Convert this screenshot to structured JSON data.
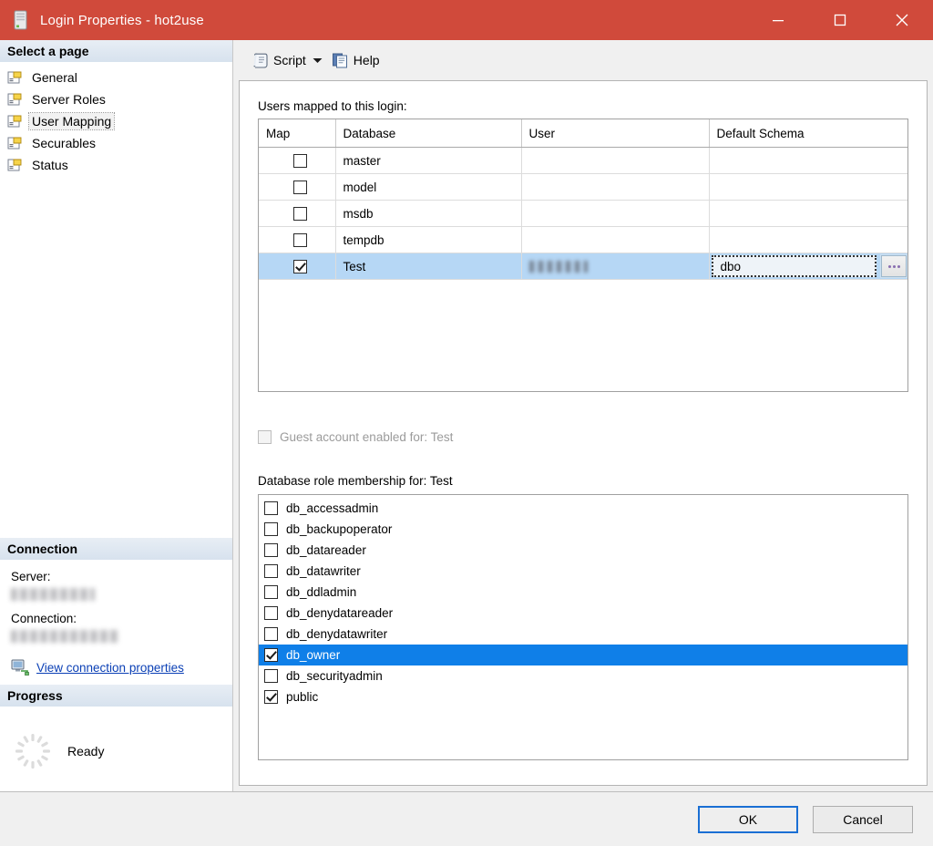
{
  "window": {
    "title": "Login Properties - hot2use",
    "icon": "server-icon",
    "accent_color": "#d04a3b",
    "controls": [
      {
        "name": "minimize",
        "glyph": "minimize-icon"
      },
      {
        "name": "maximize",
        "glyph": "maximize-icon"
      },
      {
        "name": "close",
        "glyph": "close-icon"
      }
    ]
  },
  "sidebar": {
    "select_page_header": "Select a page",
    "items": [
      {
        "label": "General",
        "selected": false
      },
      {
        "label": "Server Roles",
        "selected": false
      },
      {
        "label": "User Mapping",
        "selected": true
      },
      {
        "label": "Securables",
        "selected": false
      },
      {
        "label": "Status",
        "selected": false
      }
    ],
    "connection": {
      "header": "Connection",
      "server_label": "Server:",
      "server_value": "",
      "connection_label": "Connection:",
      "connection_value": "",
      "view_properties_link": "View connection properties"
    },
    "progress": {
      "header": "Progress",
      "status": "Ready"
    }
  },
  "toolbar": {
    "script_label": "Script",
    "help_label": "Help"
  },
  "main": {
    "users_mapped_label": "Users mapped to this login:",
    "grid": {
      "columns": [
        "Map",
        "Database",
        "User",
        "Default Schema"
      ],
      "rows": [
        {
          "map": false,
          "database": "master",
          "user": "",
          "schema": "",
          "selected": false,
          "editing": false
        },
        {
          "map": false,
          "database": "model",
          "user": "",
          "schema": "",
          "selected": false,
          "editing": false
        },
        {
          "map": false,
          "database": "msdb",
          "user": "",
          "schema": "",
          "selected": false,
          "editing": false
        },
        {
          "map": false,
          "database": "tempdb",
          "user": "",
          "schema": "",
          "selected": false,
          "editing": false
        },
        {
          "map": true,
          "database": "Test",
          "user": "REDACTED",
          "schema": "dbo",
          "selected": true,
          "editing": true
        }
      ]
    },
    "guest_account": {
      "label": "Guest account enabled for: Test",
      "checked": false,
      "disabled": true
    },
    "roles_label": "Database role membership for: Test",
    "roles": [
      {
        "label": "db_accessadmin",
        "checked": false,
        "selected": false
      },
      {
        "label": "db_backupoperator",
        "checked": false,
        "selected": false
      },
      {
        "label": "db_datareader",
        "checked": false,
        "selected": false
      },
      {
        "label": "db_datawriter",
        "checked": false,
        "selected": false
      },
      {
        "label": "db_ddladmin",
        "checked": false,
        "selected": false
      },
      {
        "label": "db_denydatareader",
        "checked": false,
        "selected": false
      },
      {
        "label": "db_denydatawriter",
        "checked": false,
        "selected": false
      },
      {
        "label": "db_owner",
        "checked": true,
        "selected": true
      },
      {
        "label": "db_securityadmin",
        "checked": false,
        "selected": false
      },
      {
        "label": "public",
        "checked": true,
        "selected": false
      }
    ],
    "ellipsis_button_label": "..."
  },
  "footer": {
    "ok_label": "OK",
    "cancel_label": "Cancel"
  },
  "colors": {
    "title_bar": "#d04a3b",
    "grid_selection": "#b6d7f5",
    "list_selection": "#0f7fe8",
    "link": "#0a3fb5"
  }
}
